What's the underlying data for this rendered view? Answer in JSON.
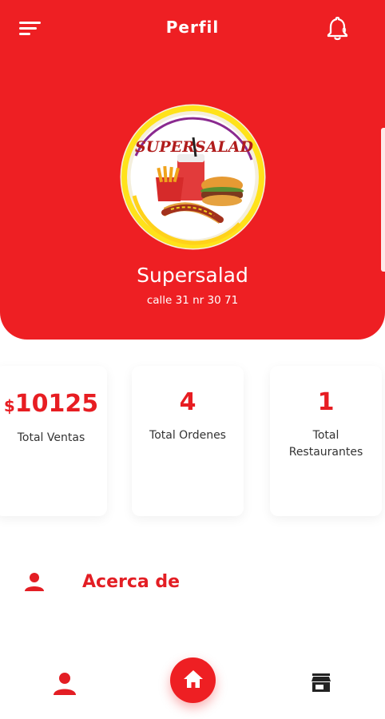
{
  "header": {
    "title": "Perfil",
    "notifications_count": "0",
    "background_color": "#ee1f23"
  },
  "logo": {
    "text": "SUPERSALAD",
    "alt": "Supersalad logo"
  },
  "profile": {
    "name": "Supersalad",
    "address": "calle 31 nr 30 71"
  },
  "stats": [
    {
      "currency": "$",
      "value": "10125",
      "label": "Total Ventas"
    },
    {
      "value": "4",
      "label": "Total Ordenes"
    },
    {
      "value": "1",
      "label": "Total Restaurantes"
    }
  ],
  "menu": {
    "about_label": "Acerca de",
    "about_icon": "person-icon"
  },
  "bottom_nav": {
    "left_icon": "person-icon",
    "center_icon": "home-icon",
    "right_icon": "store-icon"
  },
  "colors": {
    "accent": "#ee1f23",
    "text_red": "#e71d22"
  }
}
